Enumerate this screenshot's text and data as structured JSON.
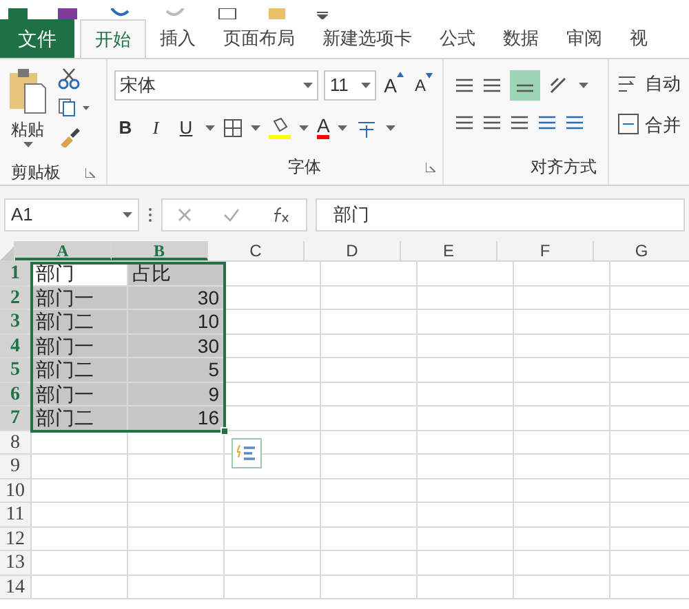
{
  "tabs": [
    {
      "label": "文件",
      "kind": "file",
      "selected": false
    },
    {
      "label": "开始",
      "kind": "tab",
      "selected": true
    },
    {
      "label": "插入",
      "kind": "tab",
      "selected": false
    },
    {
      "label": "页面布局",
      "kind": "tab",
      "selected": false
    },
    {
      "label": "新建选项卡",
      "kind": "tab",
      "selected": false
    },
    {
      "label": "公式",
      "kind": "tab",
      "selected": false
    },
    {
      "label": "数据",
      "kind": "tab",
      "selected": false
    },
    {
      "label": "审阅",
      "kind": "tab",
      "selected": false
    },
    {
      "label": "视",
      "kind": "tab",
      "selected": false
    }
  ],
  "ribbon": {
    "clipboard": {
      "paste": "粘贴",
      "label": "剪贴板"
    },
    "font": {
      "name": "宋体",
      "size": "11",
      "grow": "A",
      "shrink": "A",
      "bold": "B",
      "italic": "I",
      "underline": "U",
      "font_color": "A",
      "label": "字体"
    },
    "alignment": {
      "wrap": "自动",
      "merge": "合并",
      "label": "对齐方式",
      "middle_align_on": true
    }
  },
  "formula_bar": {
    "name_box": "A1",
    "formula": "部门"
  },
  "sheet": {
    "columns": [
      {
        "label": "A",
        "selected": true
      },
      {
        "label": "B",
        "selected": true
      },
      {
        "label": "C",
        "selected": false
      },
      {
        "label": "D",
        "selected": false
      },
      {
        "label": "E",
        "selected": false
      },
      {
        "label": "F",
        "selected": false
      },
      {
        "label": "G",
        "selected": false
      }
    ],
    "rows": [
      {
        "label": "1",
        "selected": true,
        "cells": [
          {
            "text": "部门",
            "selected": false
          },
          {
            "text": "占比",
            "selected": true
          }
        ]
      },
      {
        "label": "2",
        "selected": true,
        "cells": [
          {
            "text": "部门一",
            "selected": true
          },
          {
            "text": "30",
            "selected": true
          }
        ]
      },
      {
        "label": "3",
        "selected": true,
        "cells": [
          {
            "text": "部门二",
            "selected": true
          },
          {
            "text": "10",
            "selected": true
          }
        ]
      },
      {
        "label": "4",
        "selected": true,
        "cells": [
          {
            "text": "部门一",
            "selected": true
          },
          {
            "text": "30",
            "selected": true
          }
        ]
      },
      {
        "label": "5",
        "selected": true,
        "cells": [
          {
            "text": "部门二",
            "selected": true
          },
          {
            "text": "5",
            "selected": true
          }
        ]
      },
      {
        "label": "6",
        "selected": true,
        "cells": [
          {
            "text": "部门一",
            "selected": true
          },
          {
            "text": "9",
            "selected": true
          }
        ]
      },
      {
        "label": "7",
        "selected": true,
        "cells": [
          {
            "text": "部门二",
            "selected": true
          },
          {
            "text": "16",
            "selected": true
          }
        ]
      },
      {
        "label": "8",
        "selected": false,
        "cells": []
      },
      {
        "label": "9",
        "selected": false,
        "cells": []
      },
      {
        "label": "10",
        "selected": false,
        "cells": []
      },
      {
        "label": "11",
        "selected": false,
        "cells": []
      },
      {
        "label": "12",
        "selected": false,
        "cells": []
      },
      {
        "label": "13",
        "selected": false,
        "cells": []
      },
      {
        "label": "14",
        "selected": false,
        "cells": []
      }
    ]
  }
}
